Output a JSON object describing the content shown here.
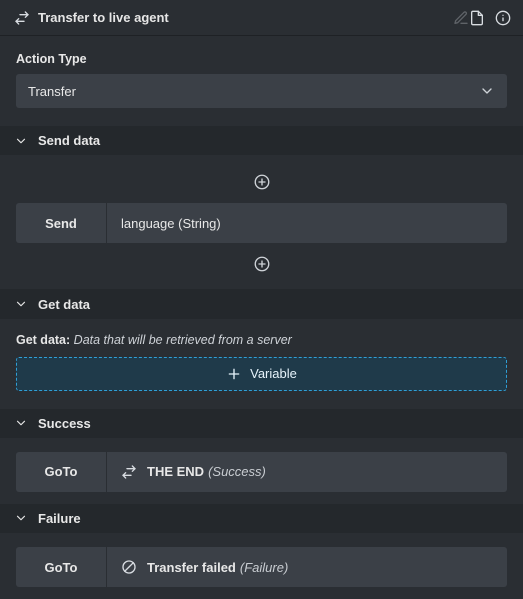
{
  "title": "Transfer to live agent",
  "action_type": {
    "label": "Action Type",
    "value": "Transfer"
  },
  "sections": {
    "send_data": {
      "header": "Send data",
      "row_label": "Send",
      "row_value": "language (String)"
    },
    "get_data": {
      "header": "Get data",
      "desc_label": "Get data:",
      "desc_value": "Data that will be retrieved from a server",
      "variable_btn": "Variable"
    },
    "success": {
      "header": "Success",
      "row_label": "GoTo",
      "row_value": "THE END",
      "row_suffix": "(Success)"
    },
    "failure": {
      "header": "Failure",
      "row_label": "GoTo",
      "row_value": "Transfer failed",
      "row_suffix": "(Failure)"
    }
  }
}
